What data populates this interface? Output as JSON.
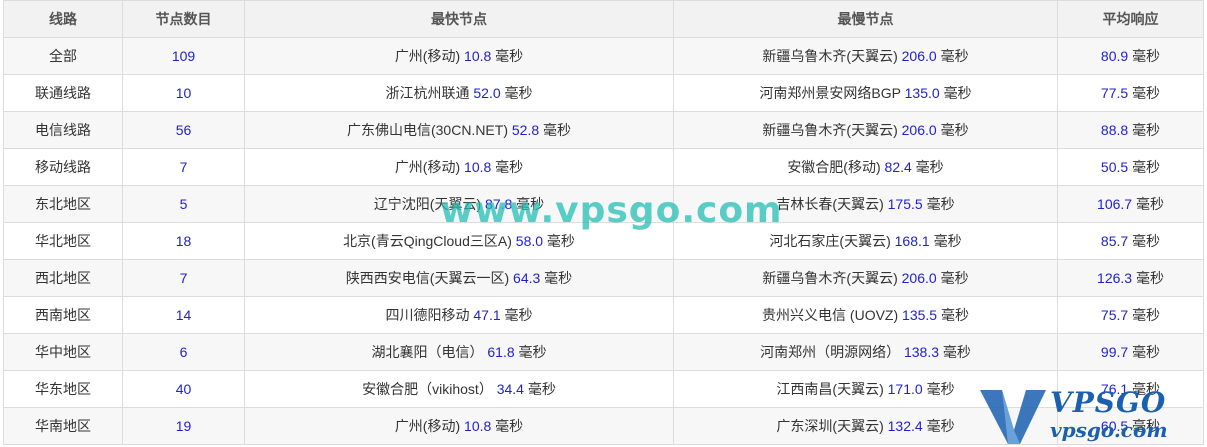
{
  "table": {
    "headers": [
      "线路",
      "节点数目",
      "最快节点",
      "最慢节点",
      "平均响应"
    ],
    "unit": "毫秒",
    "rows": [
      {
        "line": "全部",
        "count": "109",
        "fast_name": "广州(移动)",
        "fast_ms": "10.8",
        "slow_name": "新疆乌鲁木齐(天翼云)",
        "slow_ms": "206.0",
        "avg_ms": "80.9"
      },
      {
        "line": "联通线路",
        "count": "10",
        "fast_name": "浙江杭州联通",
        "fast_ms": "52.0",
        "slow_name": "河南郑州景安网络BGP",
        "slow_ms": "135.0",
        "avg_ms": "77.5"
      },
      {
        "line": "电信线路",
        "count": "56",
        "fast_name": "广东佛山电信(30CN.NET)",
        "fast_ms": "52.8",
        "slow_name": "新疆乌鲁木齐(天翼云)",
        "slow_ms": "206.0",
        "avg_ms": "88.8"
      },
      {
        "line": "移动线路",
        "count": "7",
        "fast_name": "广州(移动)",
        "fast_ms": "10.8",
        "slow_name": "安徽合肥(移动)",
        "slow_ms": "82.4",
        "avg_ms": "50.5"
      },
      {
        "line": "东北地区",
        "count": "5",
        "fast_name": "辽宁沈阳(天翼云)",
        "fast_ms": "87.8",
        "slow_name": "吉林长春(天翼云)",
        "slow_ms": "175.5",
        "avg_ms": "106.7"
      },
      {
        "line": "华北地区",
        "count": "18",
        "fast_name": "北京(青云QingCloud三区A)",
        "fast_ms": "58.0",
        "slow_name": "河北石家庄(天翼云)",
        "slow_ms": "168.1",
        "avg_ms": "85.7"
      },
      {
        "line": "西北地区",
        "count": "7",
        "fast_name": "陕西西安电信(天翼云一区)",
        "fast_ms": "64.3",
        "slow_name": "新疆乌鲁木齐(天翼云)",
        "slow_ms": "206.0",
        "avg_ms": "126.3"
      },
      {
        "line": "西南地区",
        "count": "14",
        "fast_name": "四川德阳移动",
        "fast_ms": "47.1",
        "slow_name": "贵州兴义电信 (UOVZ)",
        "slow_ms": "135.5",
        "avg_ms": "75.7"
      },
      {
        "line": "华中地区",
        "count": "6",
        "fast_name": "湖北襄阳（电信）",
        "fast_ms": "61.8",
        "slow_name": "河南郑州（明源网络）",
        "slow_ms": "138.3",
        "avg_ms": "99.7"
      },
      {
        "line": "华东地区",
        "count": "40",
        "fast_name": "安徽合肥（vikihost）",
        "fast_ms": "34.4",
        "slow_name": "江西南昌(天翼云)",
        "slow_ms": "171.0",
        "avg_ms": "76.1"
      },
      {
        "line": "华南地区",
        "count": "19",
        "fast_name": "广州(移动)",
        "fast_ms": "10.8",
        "slow_name": "广东深圳(天翼云)",
        "slow_ms": "132.4",
        "avg_ms": "60.5"
      }
    ]
  },
  "watermark": "www.vpsgo.com",
  "logo": {
    "brand": "VPSGO",
    "url": "vpsgo.com"
  },
  "colors": {
    "value": "#2222cc",
    "watermark": "#23beb4",
    "logo": "#1a5fb0"
  }
}
